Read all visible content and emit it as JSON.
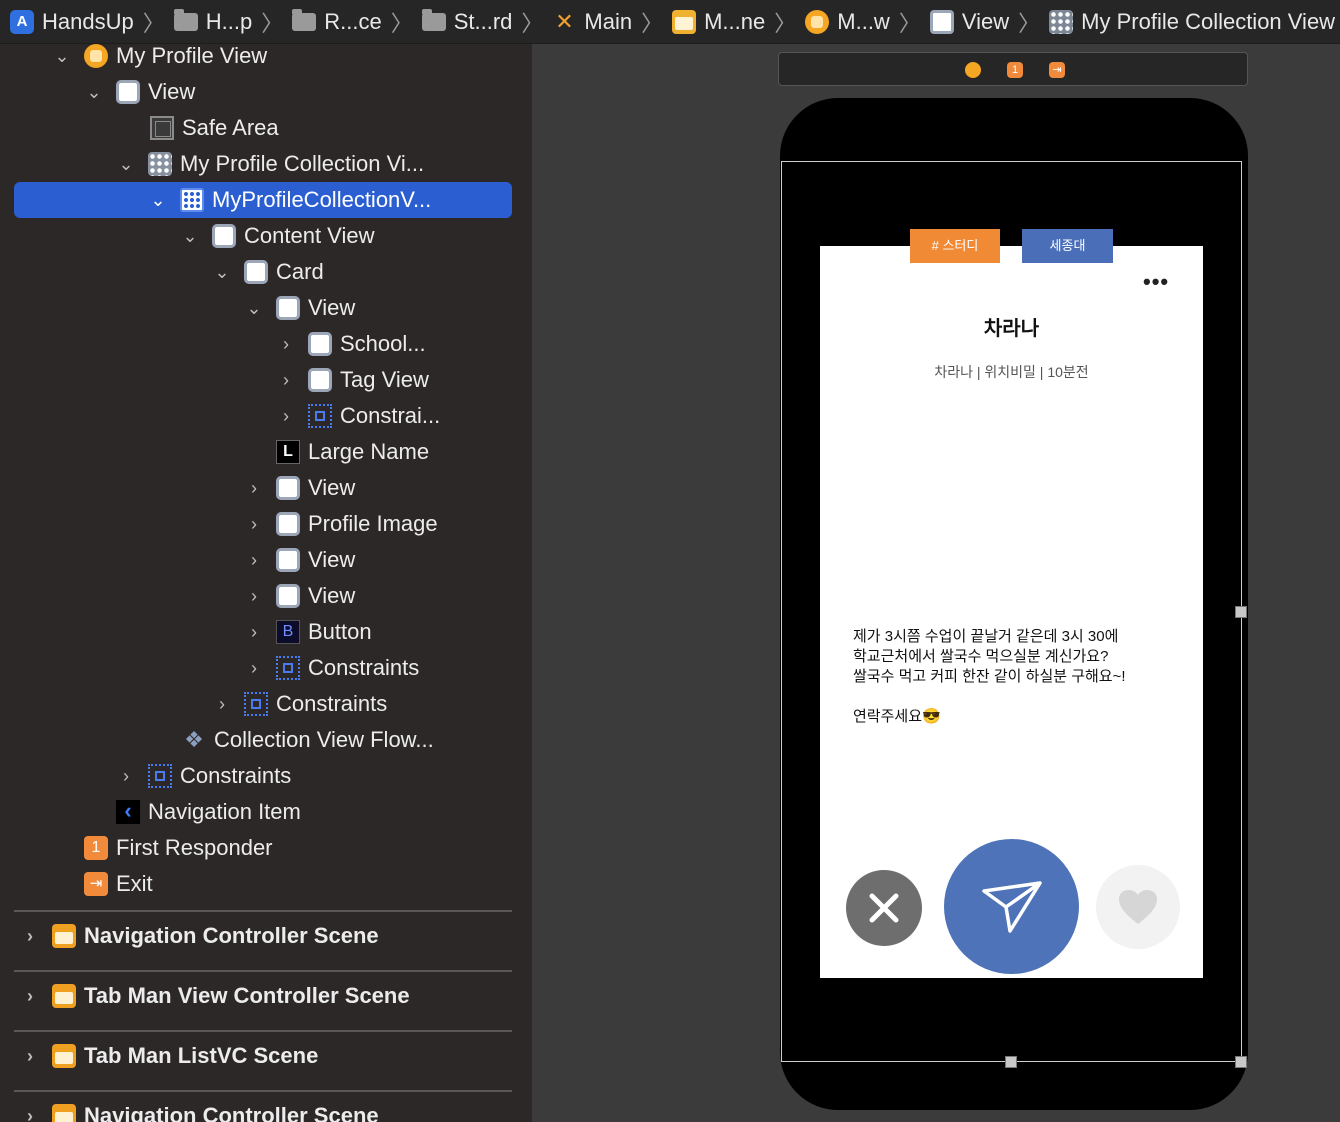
{
  "breadcrumb": [
    {
      "label": "HandsUp",
      "icon": "app-icon"
    },
    {
      "label": "H...p",
      "icon": "folder-icon"
    },
    {
      "label": "R...ce",
      "icon": "folder-icon"
    },
    {
      "label": "St...rd",
      "icon": "folder-icon"
    },
    {
      "label": "Main",
      "icon": "swift-icon"
    },
    {
      "label": "M...ne",
      "icon": "storyboard-icon"
    },
    {
      "label": "M...w",
      "icon": "view-controller-icon"
    },
    {
      "label": "View",
      "icon": "view-icon"
    },
    {
      "label": "My Profile Collection View",
      "icon": "collection-view-icon"
    }
  ],
  "outline": {
    "items": [
      {
        "label": "My Profile View"
      },
      {
        "label": "View"
      },
      {
        "label": "Safe Area"
      },
      {
        "label": "My Profile Collection Vi..."
      },
      {
        "label": "MyProfileCollectionV..."
      },
      {
        "label": "Content View"
      },
      {
        "label": "Card"
      },
      {
        "label": "View"
      },
      {
        "label": "School..."
      },
      {
        "label": "Tag View"
      },
      {
        "label": "Constrai..."
      },
      {
        "label": "Large Name"
      },
      {
        "label": "View"
      },
      {
        "label": "Profile Image"
      },
      {
        "label": "View"
      },
      {
        "label": "View"
      },
      {
        "label": "Button"
      },
      {
        "label": "Constraints"
      },
      {
        "label": "Constraints"
      },
      {
        "label": "Collection View Flow..."
      },
      {
        "label": "Constraints"
      },
      {
        "label": "Navigation Item"
      },
      {
        "label": "First Responder"
      },
      {
        "label": "Exit"
      }
    ],
    "icon_letters": {
      "label": "L",
      "button": "B",
      "first_responder": "1"
    },
    "scenes": [
      {
        "label": "Navigation Controller Scene"
      },
      {
        "label": "Tab Man View Controller Scene"
      },
      {
        "label": "Tab Man ListVC Scene"
      },
      {
        "label": "Navigation Controller Scene"
      }
    ]
  },
  "card": {
    "tags": [
      "# 스터디",
      "세종대"
    ],
    "more_label": "•••",
    "name": "차라나",
    "meta": "차라나  |  위치비밀  |  10분전",
    "body": "제가 3시쯤 수업이 끝날거 같은데 3시 30에\n학교근처에서 쌀국수 먹으실분 계신가요?\n쌀국수 먹고 커피 한잔 같이 하실분 구해요~!\n\n연락주세요😎"
  },
  "colors": {
    "selection": "#2b5fd1",
    "tag_orange": "#f08a35",
    "tag_blue": "#4a6fb8",
    "send_button": "#4e73b8",
    "reject_button": "#6e6e6e",
    "like_button": "#f2f2f2"
  }
}
